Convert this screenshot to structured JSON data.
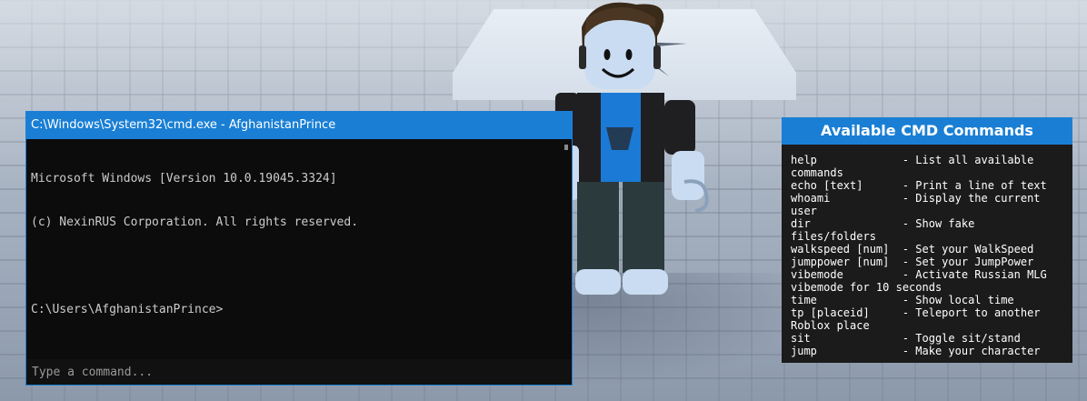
{
  "terminal": {
    "title": "C:\\Windows\\System32\\cmd.exe - AfghanistanPrince",
    "lines": [
      "Microsoft Windows [Version 10.0.19045.3324]",
      "(c) NexinRUS Corporation. All rights reserved.",
      "",
      "C:\\Users\\AfghanistanPrince>"
    ],
    "input_placeholder": "Type a command..."
  },
  "commands_panel": {
    "title": "Available CMD Commands",
    "rows": [
      "help             - List all available commands",
      "echo [text]      - Print a line of text",
      "whoami           - Display the current user",
      "dir              - Show fake files/folders",
      "walkspeed [num]  - Set your WalkSpeed",
      "jumppower [num]  - Set your JumpPower",
      "vibemode         - Activate Russian MLG vibemode for 10 seconds",
      "time             - Show local time",
      "tp [placeid]     - Teleport to another Roblox place",
      "sit              - Toggle sit/stand",
      "jump             - Make your character"
    ]
  },
  "colors": {
    "accent": "#1a7fd4",
    "terminal_bg": "#0c0c0c",
    "panel_bg": "#1b1b1b"
  }
}
